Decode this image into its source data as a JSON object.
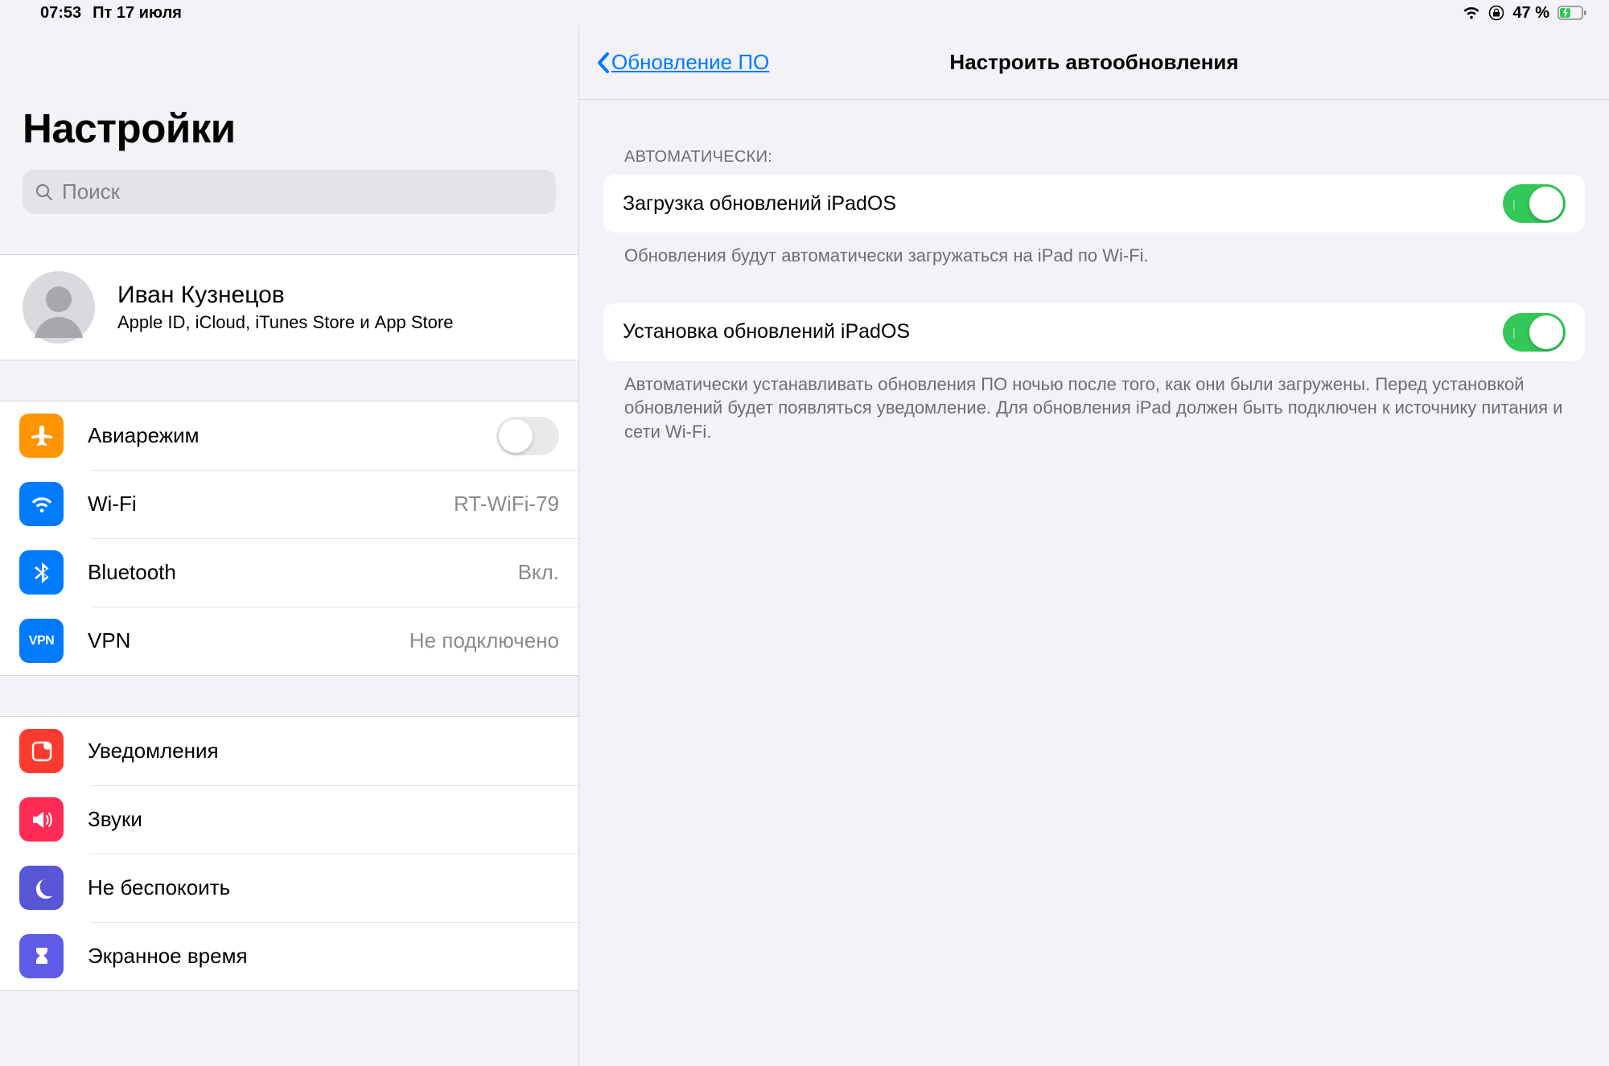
{
  "statusbar": {
    "time": "07:53",
    "date": "Пт 17 июля",
    "battery_pct": "47 %"
  },
  "sidebar": {
    "title": "Настройки",
    "search_placeholder": "Поиск",
    "account": {
      "name": "Иван Кузнецов",
      "subtitle": "Apple ID, iCloud, iTunes Store и App Store"
    },
    "group_connectivity": [
      {
        "key": "airplane",
        "label": "Авиарежим",
        "value": "",
        "toggle": false
      },
      {
        "key": "wifi",
        "label": "Wi-Fi",
        "value": "RT-WiFi-79"
      },
      {
        "key": "bluetooth",
        "label": "Bluetooth",
        "value": "Вкл."
      },
      {
        "key": "vpn",
        "label": "VPN",
        "value": "Не подключено"
      }
    ],
    "group_notifications": [
      {
        "key": "notifications",
        "label": "Уведомления"
      },
      {
        "key": "sounds",
        "label": "Звуки"
      },
      {
        "key": "dnd",
        "label": "Не беспокоить"
      },
      {
        "key": "screentime",
        "label": "Экранное время"
      }
    ]
  },
  "detail": {
    "back_label": "Обновление ПО",
    "title": "Настроить автообновления",
    "section_auto_header": "АВТОМАТИЧЕСКИ:",
    "download": {
      "label": "Загрузка обновлений iPadOS",
      "on": true,
      "footer": "Обновления будут автоматически загружаться на iPad по Wi-Fi."
    },
    "install": {
      "label": "Установка обновлений iPadOS",
      "on": true,
      "footer": "Автоматически устанавливать обновления ПО ночью после того, как они были загружены. Перед установкой обновлений будет появляться уведомление. Для обновления iPad должен быть подключен к источнику питания и сети Wi-Fi."
    }
  }
}
